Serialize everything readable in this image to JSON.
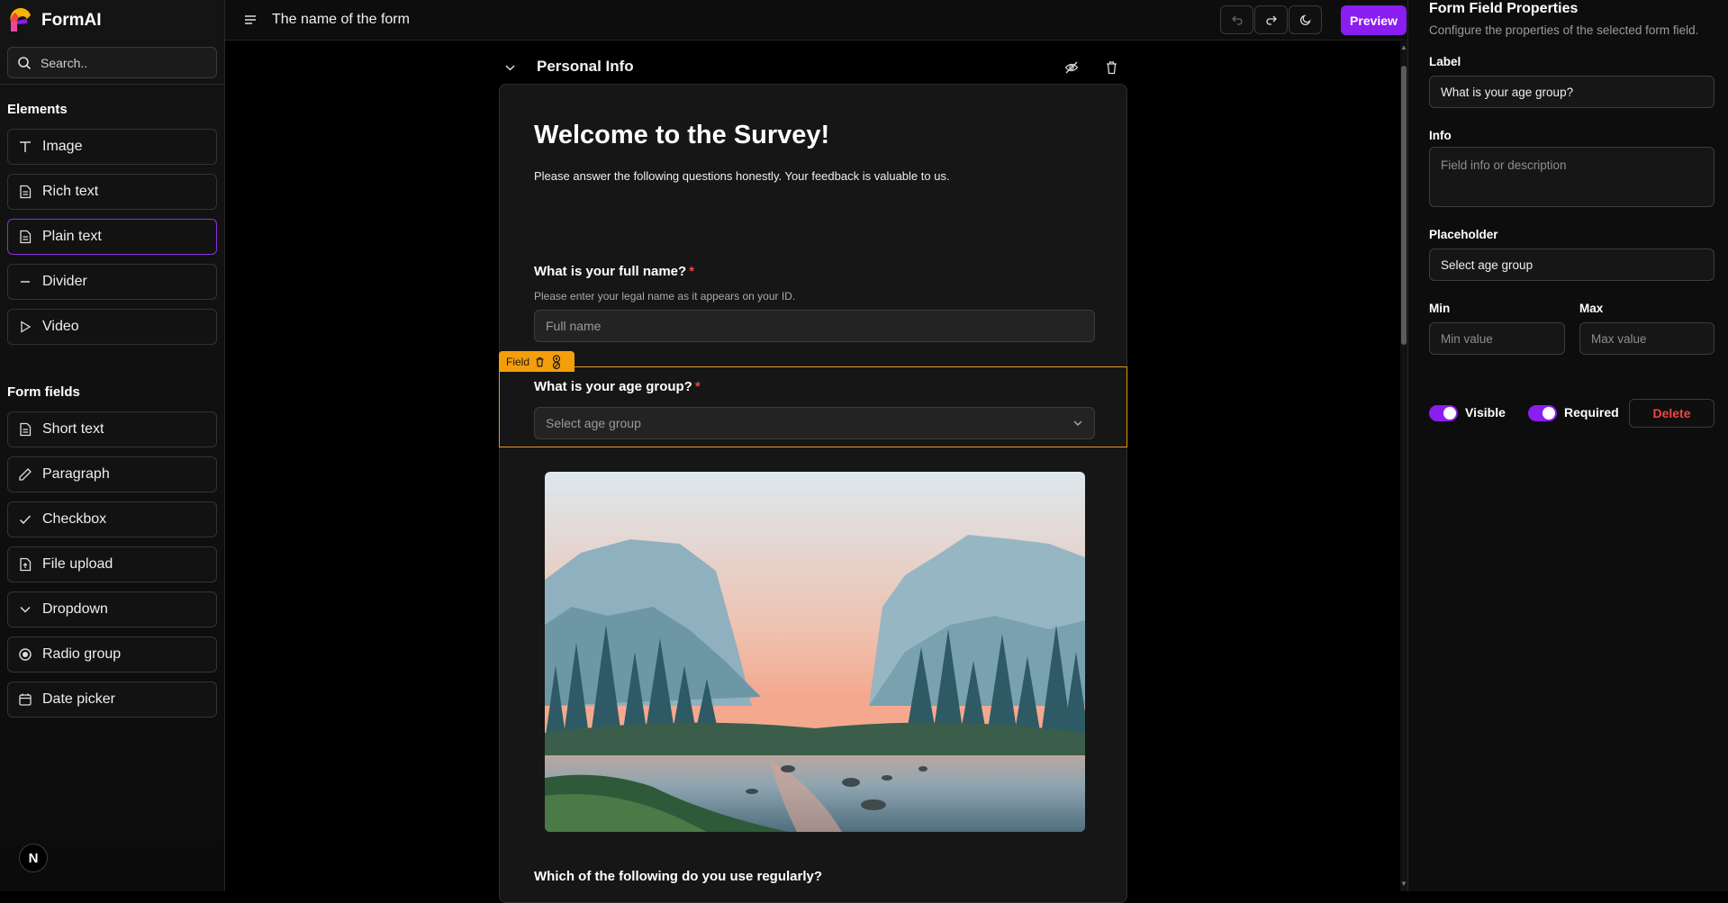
{
  "app": {
    "name": "FormAI"
  },
  "sidebar": {
    "search_placeholder": "Search..",
    "elements_title": "Elements",
    "elements": [
      {
        "label": "Image",
        "icon": "text-type-icon"
      },
      {
        "label": "Rich text",
        "icon": "document-icon"
      },
      {
        "label": "Plain text",
        "icon": "document-icon"
      },
      {
        "label": "Divider",
        "icon": "minus-icon"
      },
      {
        "label": "Video",
        "icon": "play-icon"
      }
    ],
    "form_fields_title": "Form fields",
    "form_fields": [
      {
        "label": "Short text",
        "icon": "document-icon"
      },
      {
        "label": "Paragraph",
        "icon": "pencil-icon"
      },
      {
        "label": "Checkbox",
        "icon": "check-icon"
      },
      {
        "label": "File upload",
        "icon": "file-upload-icon"
      },
      {
        "label": "Dropdown",
        "icon": "chevron-down-icon"
      },
      {
        "label": "Radio group",
        "icon": "radio-icon"
      },
      {
        "label": "Date picker",
        "icon": "calendar-icon"
      }
    ],
    "badge": "N"
  },
  "topbar": {
    "form_title": "The name of the form",
    "preview_label": "Preview",
    "accent": "#8a1df0"
  },
  "canvas": {
    "section_name": "Personal Info",
    "welcome_title": "Welcome to the Survey!",
    "welcome_subtitle": "Please answer the following questions honestly. Your feedback is valuable to us.",
    "q1": {
      "label": "What is your full name?",
      "required_mark": "*",
      "info": "Please enter your legal name as it appears on your ID.",
      "placeholder": "Full name"
    },
    "field_tag": "Field",
    "q2": {
      "label": "What is your age group?",
      "required_mark": "*",
      "placeholder": "Select age group"
    },
    "q3": {
      "label": "Which of the following do you use regularly?"
    }
  },
  "properties": {
    "title": "Form Field Properties",
    "subtitle": "Configure the properties of the selected form field.",
    "label_title": "Label",
    "label_value": "What is your age group?",
    "info_title": "Info",
    "info_placeholder": "Field info or description",
    "placeholder_title": "Placeholder",
    "placeholder_value": "Select age group",
    "min_title": "Min",
    "min_placeholder": "Min value",
    "max_title": "Max",
    "max_placeholder": "Max value",
    "visible_label": "Visible",
    "visible_on": true,
    "required_label": "Required",
    "required_on": true,
    "delete_label": "Delete",
    "delete_color": "#ef4444"
  }
}
